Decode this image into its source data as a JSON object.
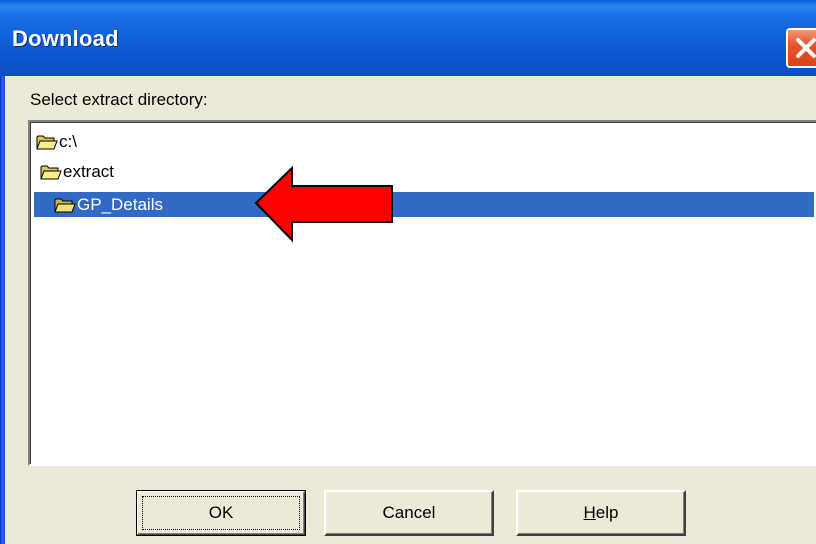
{
  "window": {
    "title": "Download"
  },
  "dialog": {
    "prompt": "Select extract directory:"
  },
  "tree": {
    "items": [
      {
        "label": "c:\\",
        "icon": "open-folder-icon",
        "selected": false
      },
      {
        "label": "extract",
        "icon": "open-folder-icon",
        "selected": false
      },
      {
        "label": "GP_Details",
        "icon": "open-folder-icon",
        "selected": true
      }
    ]
  },
  "buttons": {
    "ok_label": "OK",
    "cancel_label": "Cancel",
    "help_label_prefix": "H",
    "help_label_rest": "elp"
  },
  "annotation": {
    "icon": "red-arrow-icon",
    "color": "#ff0000"
  },
  "colors": {
    "titlebar": "#0a5fd8",
    "selection": "#316ac5",
    "close_button": "#e4582f"
  }
}
